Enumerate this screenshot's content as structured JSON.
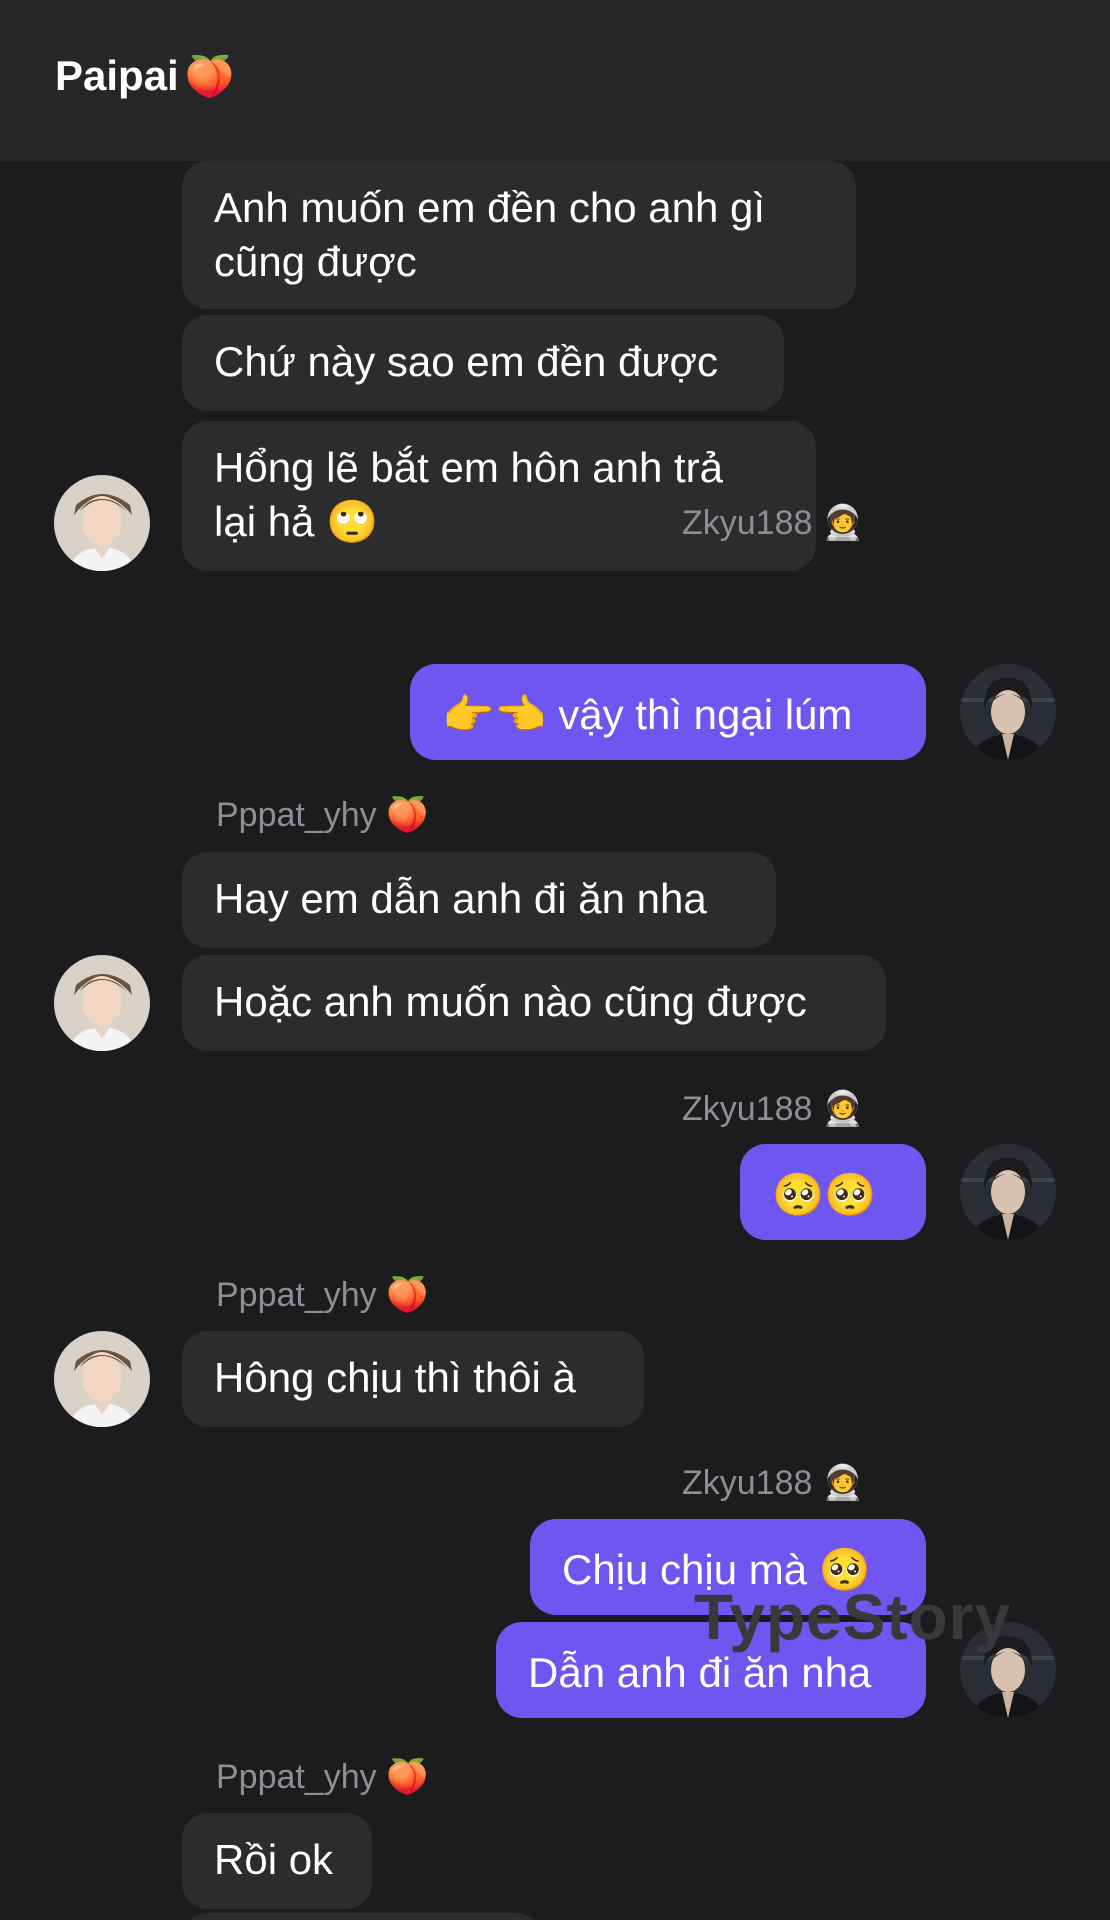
{
  "header": {
    "title": "Paipai",
    "title_emoji": "🍑"
  },
  "messages": {
    "m1": "Anh muốn em đền cho anh gì",
    "m1b": "cũng được",
    "m2": "Chứ này sao em đền được",
    "m3": "Hổng lẽ bắt em hôn anh trả",
    "m3b": "lại hả 🙄",
    "m4": "👉👈 vậy thì ngại lúm",
    "m5": "Hay em dẫn anh đi ăn nha",
    "m6": "Hoặc anh muốn nào cũng được",
    "m7": "🥺🥺",
    "m8": "Hông chịu thì thôi à",
    "m9": "Chịu chịu mà 🥺",
    "m10": "Dẫn anh đi ăn nha",
    "m11": "Rồi ok"
  },
  "senders": {
    "me": "Zkyu188 🧑‍🚀",
    "them": "Pppat_yhy 🍑"
  },
  "watermark": "TypeStory",
  "colors": {
    "background": "#1c1c1e",
    "header": "#262628",
    "incoming_bubble": "#2c2c2e",
    "outgoing_bubble": "#7056f0",
    "sender_text": "#8e8e93"
  },
  "icons": {
    "incoming_avatar": "avatar-man-light-icon",
    "outgoing_avatar": "avatar-man-dark-icon"
  }
}
